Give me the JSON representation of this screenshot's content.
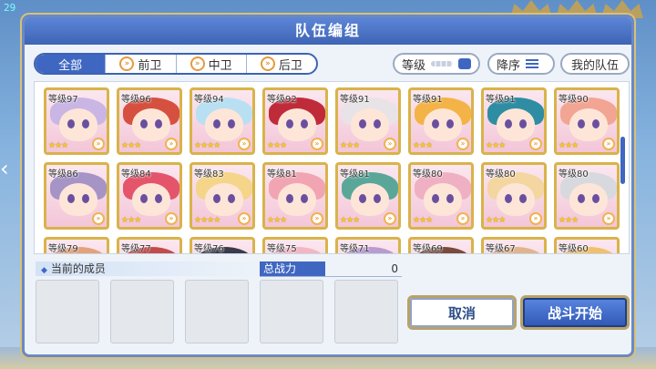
{
  "fps": "29",
  "dialog": {
    "title": "队伍编组"
  },
  "tabs": [
    {
      "label": "全部",
      "active": true,
      "icon": ""
    },
    {
      "label": "前卫",
      "active": false,
      "icon": "chevron-icon"
    },
    {
      "label": "中卫",
      "active": false,
      "icon": "chevron-icon"
    },
    {
      "label": "后卫",
      "active": false,
      "icon": "chevron-icon"
    }
  ],
  "filters": {
    "level_label": "等级",
    "sort_label": "降序",
    "my_team_label": "我的队伍"
  },
  "characters": [
    {
      "level": "等级97",
      "stars": "★★★",
      "hair": "#c9b6e4"
    },
    {
      "level": "等级96",
      "stars": "★★★",
      "hair": "#d6503f"
    },
    {
      "level": "等级94",
      "stars": "★★★★",
      "hair": "#b9e0f2"
    },
    {
      "level": "等级92",
      "stars": "★★★",
      "hair": "#c02b3a"
    },
    {
      "level": "等级91",
      "stars": "★★★",
      "hair": "#e8e3e6"
    },
    {
      "level": "等级91",
      "stars": "★★★",
      "hair": "#f3b347"
    },
    {
      "level": "等级91",
      "stars": "★★★",
      "hair": "#2f8da3"
    },
    {
      "level": "等级90",
      "stars": "★★★",
      "hair": "#f2a593"
    },
    {
      "level": "等级86",
      "stars": "",
      "hair": "#a694c7"
    },
    {
      "level": "等级84",
      "stars": "★★★",
      "hair": "#e4556b"
    },
    {
      "level": "等级83",
      "stars": "★★★★",
      "hair": "#f4d58a"
    },
    {
      "level": "等级81",
      "stars": "★★★",
      "hair": "#f1a5b3"
    },
    {
      "level": "等级81",
      "stars": "★★★",
      "hair": "#5aa79a"
    },
    {
      "level": "等级80",
      "stars": "★★★",
      "hair": "#efb0c3"
    },
    {
      "level": "等级80",
      "stars": "★★★",
      "hair": "#f3d6a0"
    },
    {
      "level": "等级80",
      "stars": "★★★",
      "hair": "#d7d9de"
    },
    {
      "level": "等级79",
      "stars": "",
      "hair": "#e3a27a"
    },
    {
      "level": "等级77",
      "stars": "",
      "hair": "#c44b4b"
    },
    {
      "level": "等级76",
      "stars": "",
      "hair": "#3b3b4a"
    },
    {
      "level": "等级75",
      "stars": "",
      "hair": "#f3b6c2"
    },
    {
      "level": "等级71",
      "stars": "",
      "hair": "#b99bd0"
    },
    {
      "level": "等级69",
      "stars": "",
      "hair": "#7c4a3a"
    },
    {
      "level": "等级67",
      "stars": "",
      "hair": "#e2b48d"
    },
    {
      "level": "等级60",
      "stars": "",
      "hair": "#f1c06a"
    }
  ],
  "members": {
    "label": "当前的成员"
  },
  "power": {
    "label": "总战力",
    "value": "0"
  },
  "buttons": {
    "cancel": "取消",
    "start": "战斗开始"
  }
}
